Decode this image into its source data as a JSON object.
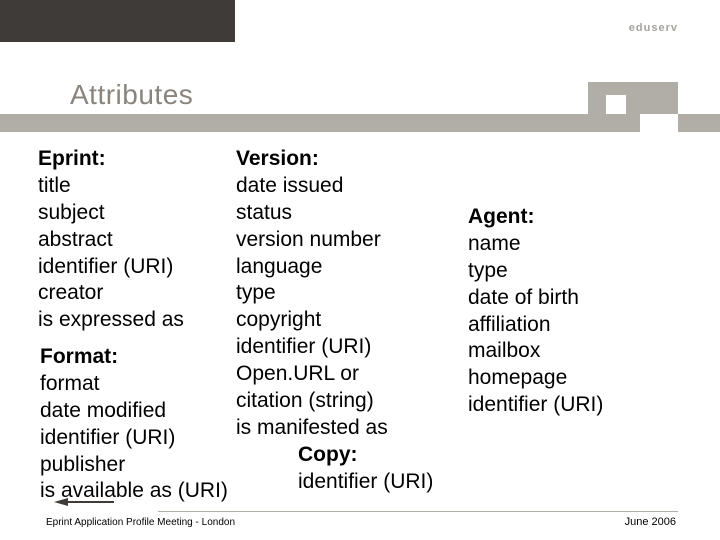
{
  "brand": {
    "name": "eduserv"
  },
  "title": "Attributes",
  "columns": {
    "eprint": {
      "heading": "Eprint:",
      "items": [
        "title",
        "subject",
        "abstract",
        "identifier (URI)",
        "creator",
        "is expressed as"
      ]
    },
    "version": {
      "heading": "Version:",
      "items": [
        "date issued",
        "status",
        "version number",
        "language",
        "type",
        "copyright",
        "identifier (URI)",
        "Open.URL or",
        "citation (string)",
        "is manifested as"
      ]
    },
    "agent": {
      "heading": "Agent:",
      "items": [
        "name",
        "type",
        "date of birth",
        "affiliation",
        "mailbox",
        "homepage",
        "identifier (URI)"
      ]
    },
    "format": {
      "heading": "Format:",
      "items": [
        "format",
        "date modified",
        "identifier (URI)",
        "publisher",
        "is available as (URI)"
      ]
    },
    "copy": {
      "heading": "Copy:",
      "items": [
        "identifier (URI)"
      ]
    }
  },
  "footer": {
    "left": "Eprint Application Profile Meeting - London",
    "right": "June 2006"
  }
}
